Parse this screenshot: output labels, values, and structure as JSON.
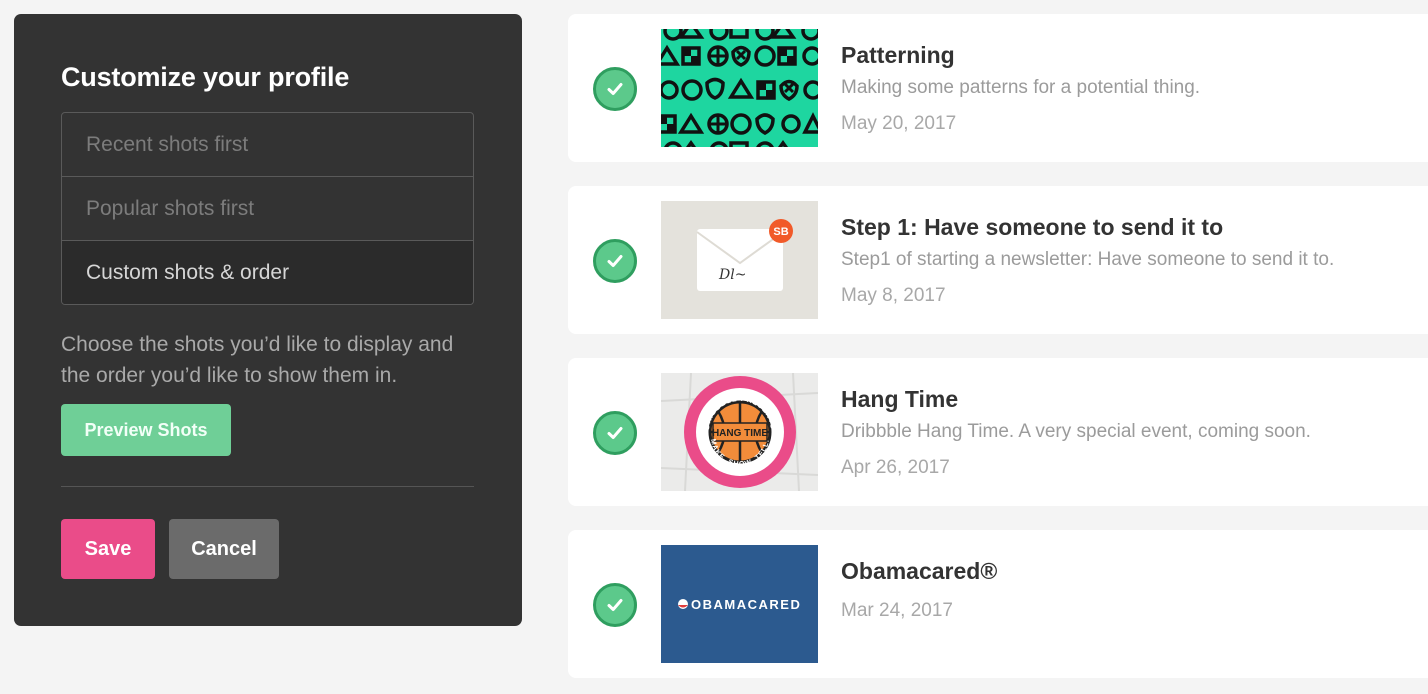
{
  "panel": {
    "title": "Customize your profile",
    "options": [
      {
        "label": "Recent shots first",
        "selected": false
      },
      {
        "label": "Popular shots first",
        "selected": false
      },
      {
        "label": "Custom shots & order",
        "selected": true
      }
    ],
    "description": "Choose the shots you’d like to display and the order you’d like to show them in.",
    "preview_label": "Preview Shots",
    "save_label": "Save",
    "cancel_label": "Cancel"
  },
  "shots": [
    {
      "title": "Patterning",
      "description": "Making some patterns for a potential thing.",
      "date": "May 20, 2017",
      "checked": true,
      "thumb": "pattern-shapes"
    },
    {
      "title": "Step 1: Have someone to send it to",
      "description": "Step1 of starting a newsletter: Have someone to send it to.",
      "date": "May 8, 2017",
      "checked": true,
      "thumb": "envelope",
      "badge": "SB",
      "signature": "Dl~"
    },
    {
      "title": "Hang Time",
      "description": "Dribbble Hang Time. A very special event, coming soon.",
      "date": "Apr 26, 2017",
      "checked": true,
      "thumb": "hang-time-badge",
      "badge_top": "DRIBBBLE PRESENTS",
      "badge_center": "HANG TIME",
      "badge_bottom": "MAKE. SHOW. TELL."
    },
    {
      "title": "Obamacared®",
      "description": "",
      "date": "Mar 24, 2017",
      "checked": true,
      "thumb": "obamacared-logo",
      "logo_text": "OBAMACARED"
    }
  ],
  "colors": {
    "panel_bg": "#333333",
    "accent_pink": "#ea4c89",
    "accent_green": "#6fcf97",
    "check_green": "#5cc98b",
    "pattern_green": "#1ed6a0",
    "obama_blue": "#2c5a8f"
  }
}
